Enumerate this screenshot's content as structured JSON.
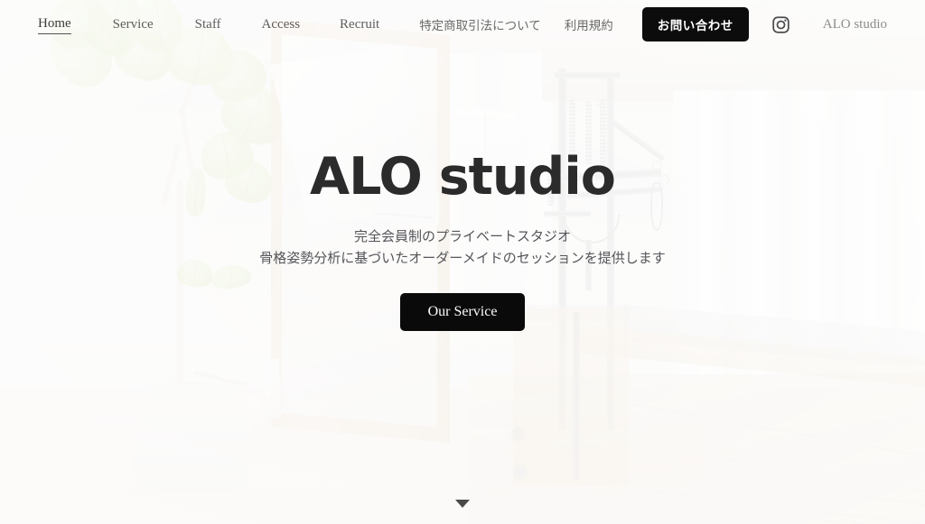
{
  "nav": {
    "links": [
      {
        "label": "Home",
        "active": true,
        "lang": "en"
      },
      {
        "label": "Service",
        "active": false,
        "lang": "en"
      },
      {
        "label": "Staff",
        "active": false,
        "lang": "en"
      },
      {
        "label": "Access",
        "active": false,
        "lang": "en"
      },
      {
        "label": "Recruit",
        "active": false,
        "lang": "en"
      },
      {
        "label": "特定商取引法について",
        "active": false,
        "lang": "jp"
      },
      {
        "label": "利用規約",
        "active": false,
        "lang": "jp"
      }
    ],
    "contact_button": "お問い合わせ",
    "instagram_icon": "instagram-icon",
    "brand": "ALO studio"
  },
  "hero": {
    "title": "ALO studio",
    "subtitle_line1": "完全会員制のプライベートスタジオ",
    "subtitle_line2": "骨格姿勢分析に基づいたオーダーメイドのセッションを提供します",
    "cta_button": "Our Service",
    "scroll_icon": "chevron-down-icon"
  },
  "colors": {
    "accent_black": "#0c0c0c",
    "text_dark": "#2b2b2b",
    "text_muted": "#5d5d5b",
    "brand_gray": "#8d8d8a",
    "page_bg": "#eae9e7"
  }
}
